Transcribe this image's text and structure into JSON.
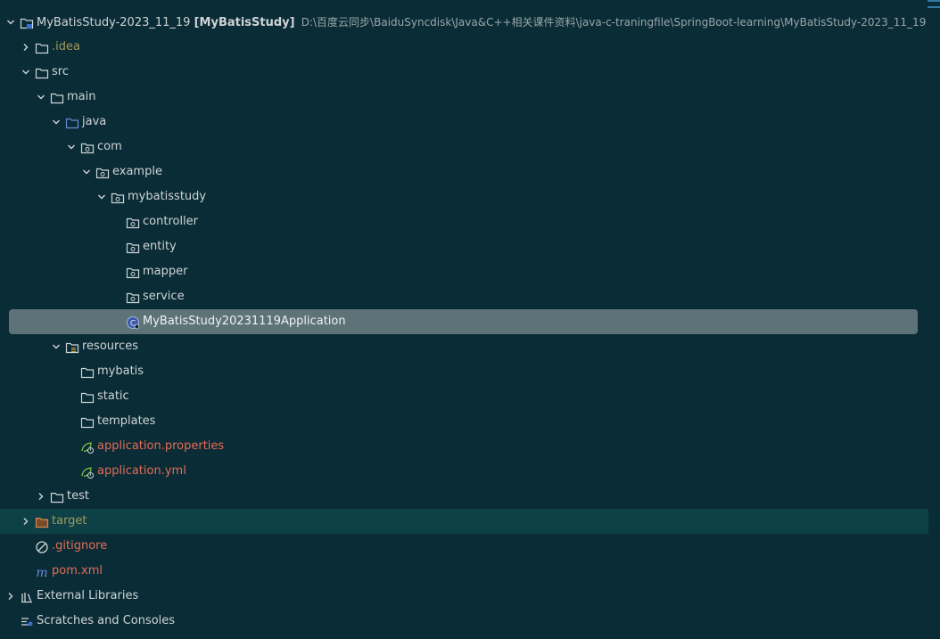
{
  "project": {
    "name": "MyBatisStudy-2023_11_19",
    "module": "[MyBatisStudy]",
    "path": "D:\\百度云同步\\BaiduSyncdisk\\Java&C++相关课件资料\\java-c-traningfile\\SpringBoot-learning\\MyBatisStudy-2023_11_19"
  },
  "tree": {
    "idea": ".idea",
    "src": "src",
    "main": "main",
    "java": "java",
    "com": "com",
    "example": "example",
    "mybatisstudy": "mybatisstudy",
    "controller": "controller",
    "entity": "entity",
    "mapper": "mapper",
    "service": "service",
    "app_class": "MyBatisStudy20231119Application",
    "resources": "resources",
    "mybatis": "mybatis",
    "static": "static",
    "templates": "templates",
    "app_properties": "application.properties",
    "app_yml": "application.yml",
    "test": "test",
    "target": "target",
    "gitignore": ".gitignore",
    "pom": "pom.xml",
    "external_libraries": "External Libraries",
    "scratches": "Scratches and Consoles"
  },
  "colors": {
    "background": "#0a2c36",
    "selection": "#5e7378",
    "excluded": "#a39a55",
    "unversioned": "#e46c55",
    "source_root": "#6a8bd8"
  },
  "icons": {
    "folder": "folder-icon",
    "package": "package-icon",
    "source_root": "source-root-folder-icon",
    "resources_root": "resources-root-folder-icon",
    "spring_config": "spring-config-icon",
    "class": "spring-boot-class-icon",
    "ignore": "gitignore-icon",
    "maven": "maven-icon",
    "libraries": "libraries-icon",
    "scratches": "scratches-icon"
  }
}
